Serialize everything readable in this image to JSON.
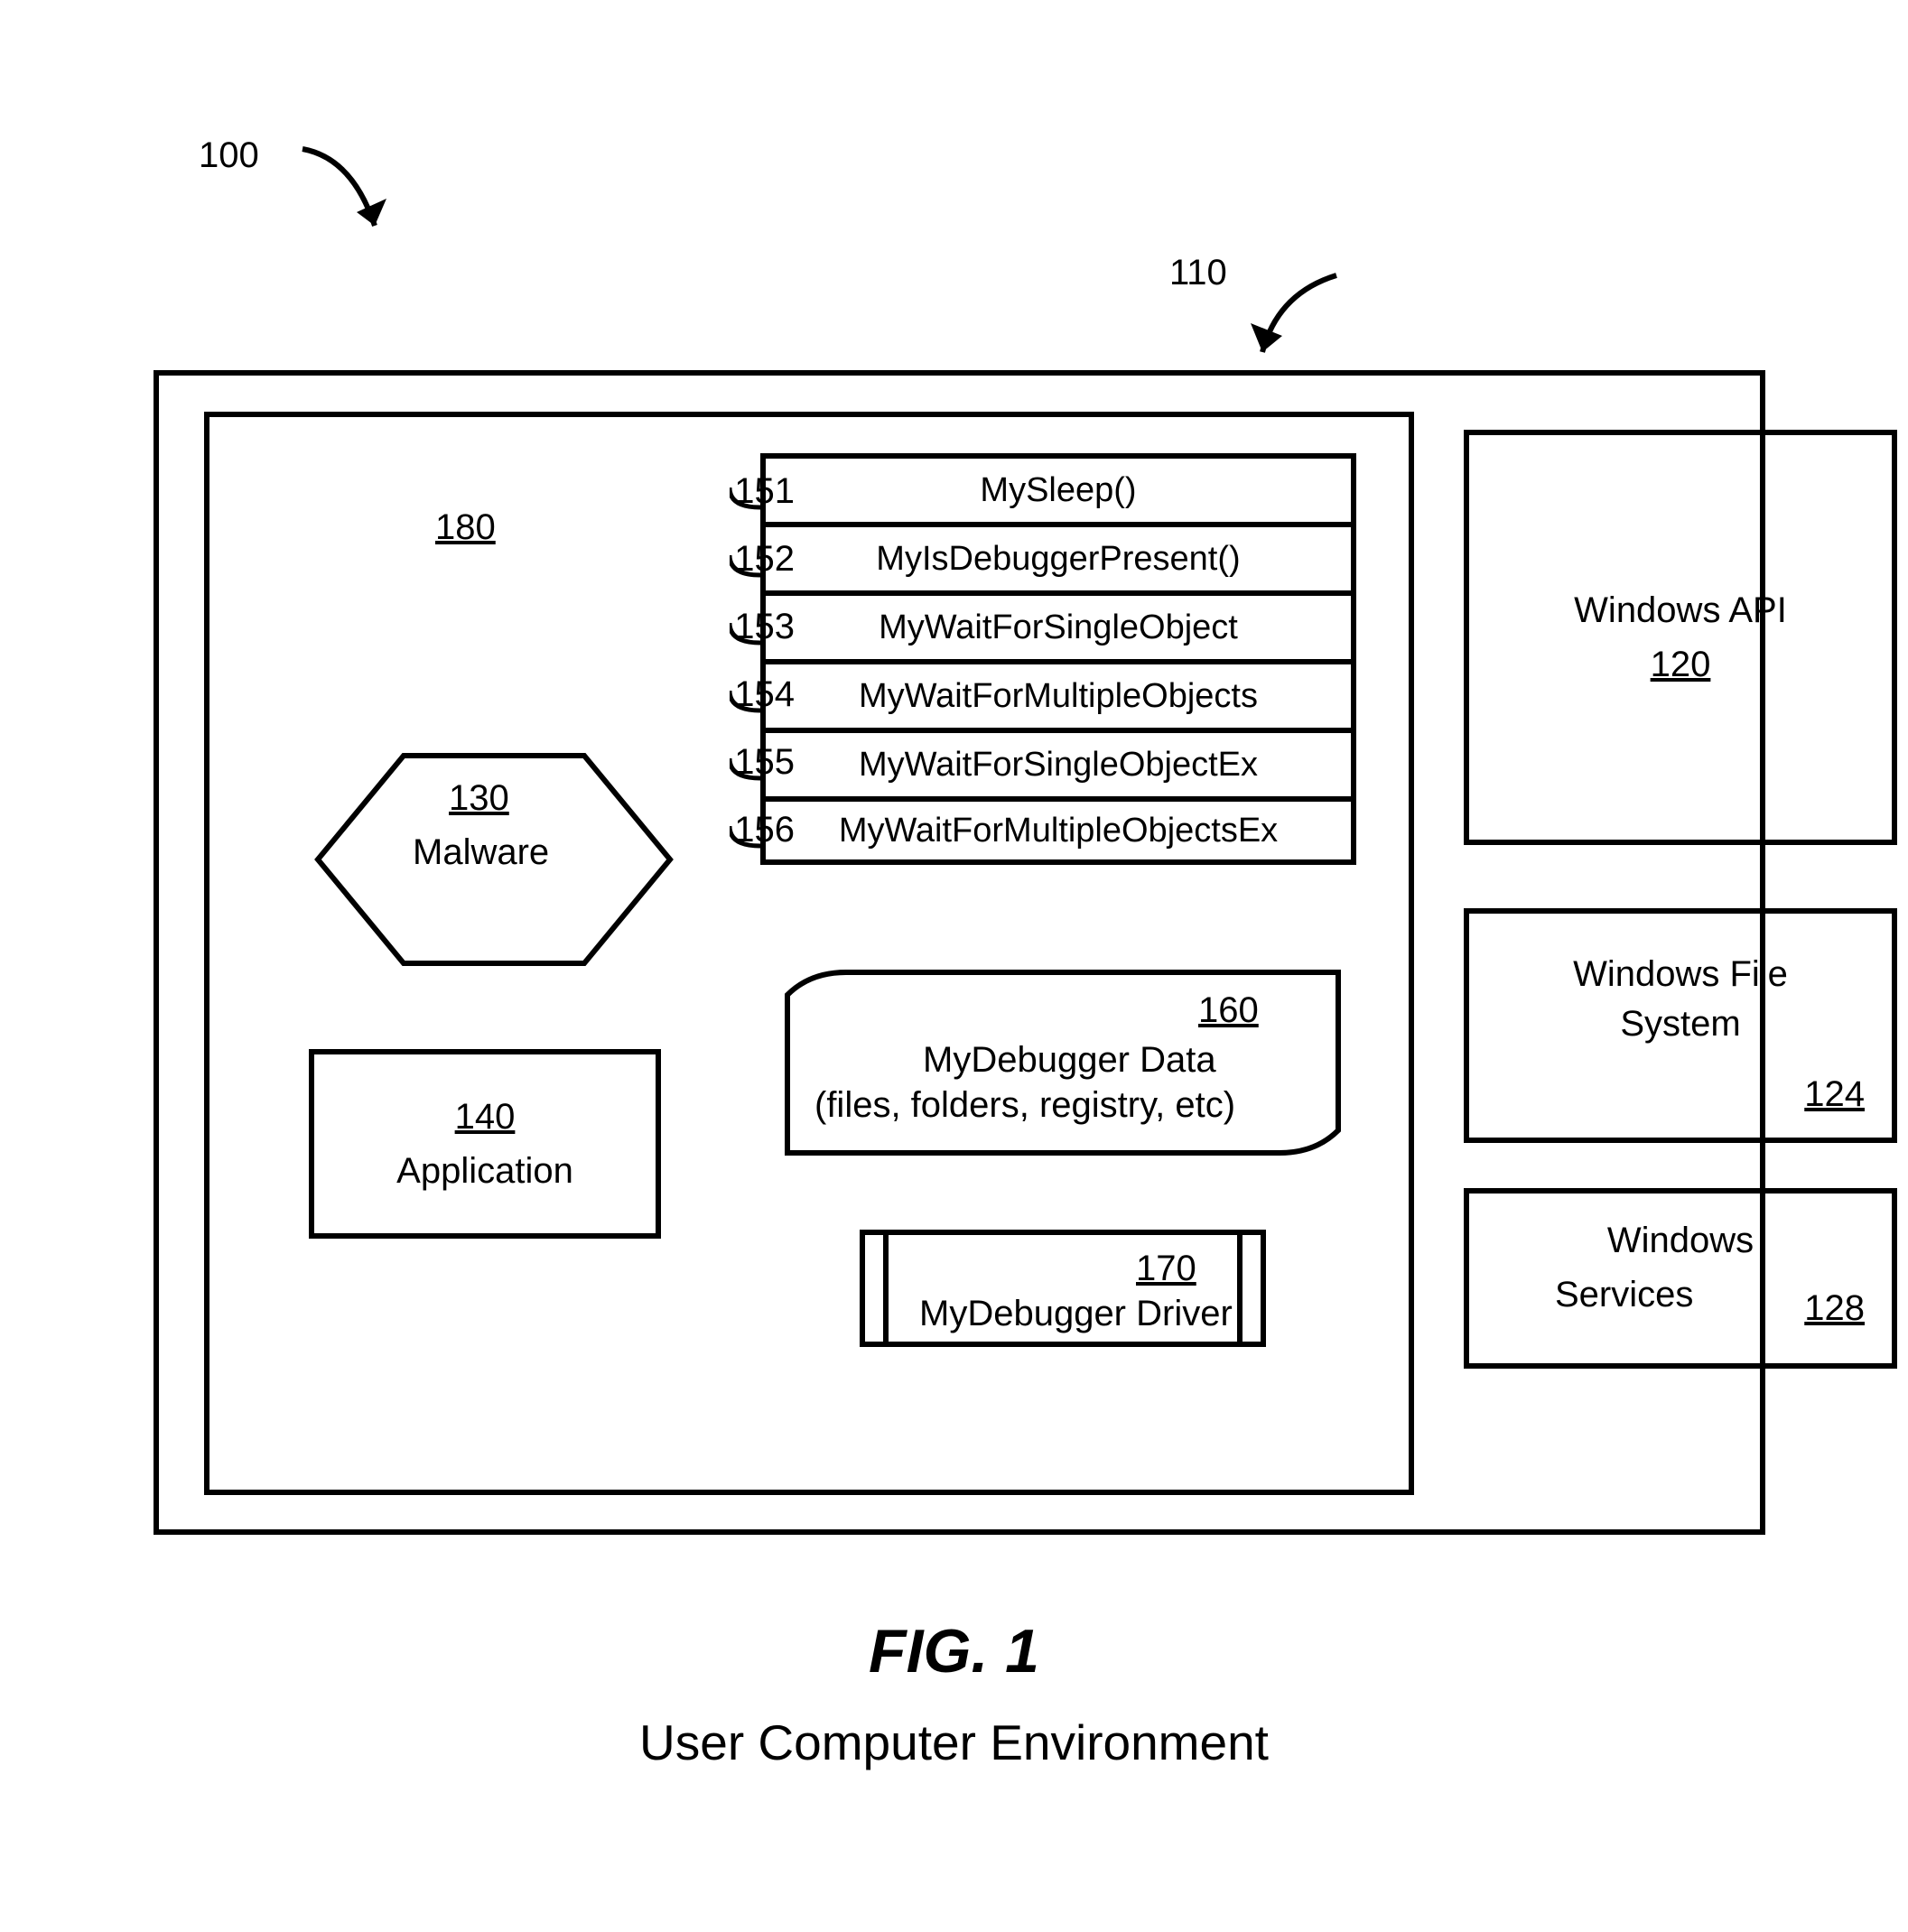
{
  "refs": {
    "r100": "100",
    "r110": "110",
    "r180": "180",
    "r130": "130",
    "r140": "140",
    "r160": "160",
    "r170": "170",
    "r120": "120",
    "r124": "124",
    "r128": "128",
    "r151": "151",
    "r152": "152",
    "r153": "153",
    "r154": "154",
    "r155": "155",
    "r156": "156"
  },
  "funcs": {
    "f151": "MySleep()",
    "f152": "MyIsDebuggerPresent()",
    "f153": "MyWaitForSingleObject",
    "f154": "MyWaitForMultipleObjects",
    "f155": "MyWaitForSingleObjectEx",
    "f156": "MyWaitForMultipleObjectsEx"
  },
  "labels": {
    "malware": "Malware",
    "application": "Application",
    "data_l1": "MyDebugger Data",
    "data_l2": "(files, folders, registry, etc)",
    "driver": "MyDebugger Driver",
    "win_api": "Windows API",
    "win_fs_l1": "Windows File",
    "win_fs_l2": "System",
    "win_sv_l1": "Windows",
    "win_sv_l2": "Services"
  },
  "caption": {
    "title": "FIG. 1",
    "subtitle": "User Computer Environment"
  }
}
